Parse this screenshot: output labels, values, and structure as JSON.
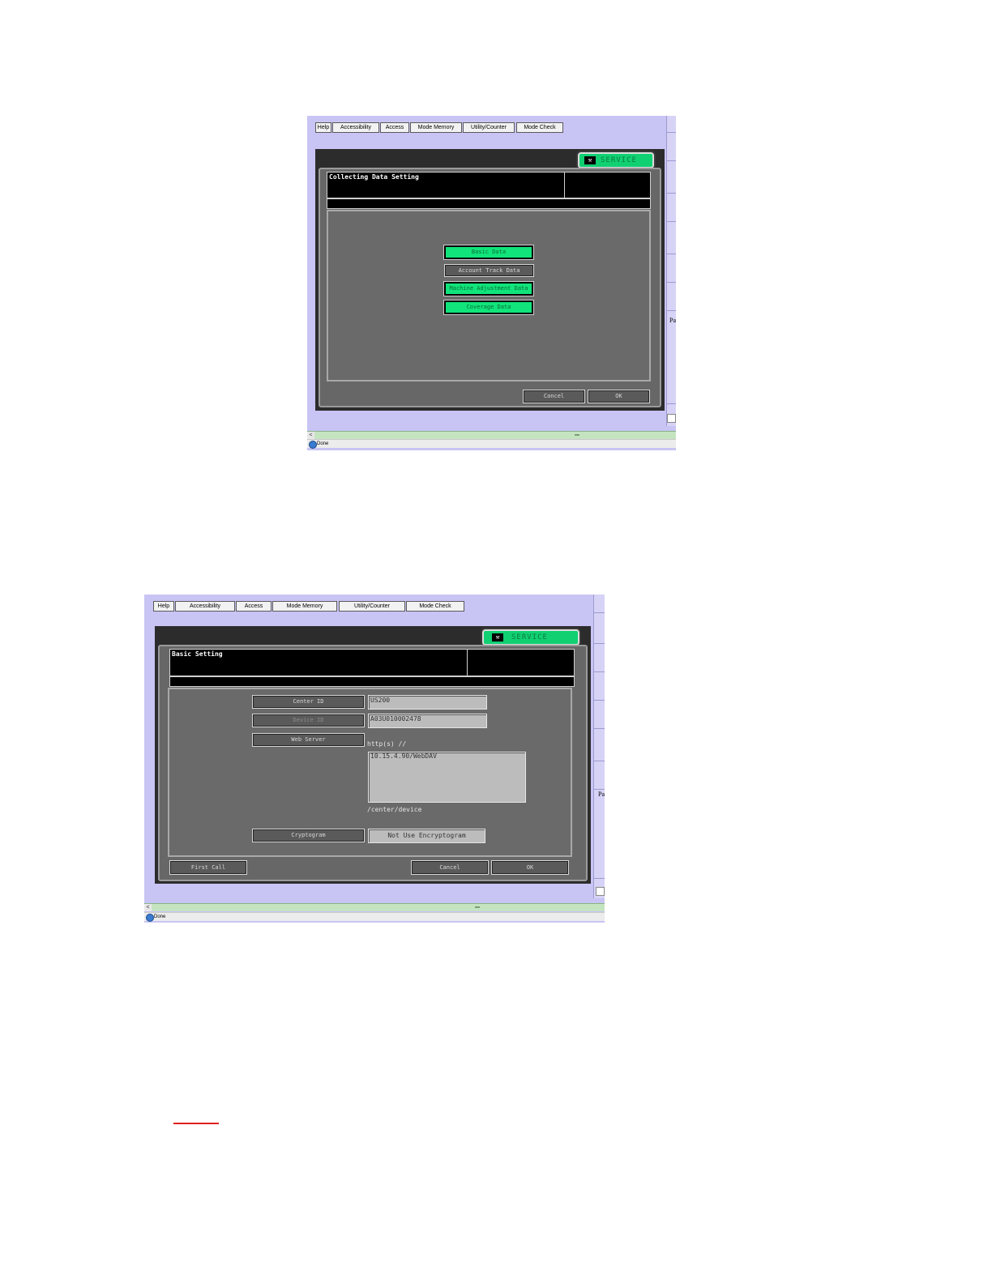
{
  "tabs": [
    "Help",
    "Accessibility",
    "Access",
    "Mode Memory",
    "Utility/Counter",
    "Mode Check"
  ],
  "service_label": "SERVICE",
  "service_icon": "wrench-icon",
  "edge_text": "Pa",
  "status_text": "Done",
  "screen1": {
    "title": "Collecting Data Setting",
    "options": [
      {
        "label": "Basic Data",
        "selected": true
      },
      {
        "label": "Account Track Data",
        "selected": false
      },
      {
        "label": "Machine Adjustment Data",
        "selected": true
      },
      {
        "label": "Coverage Data",
        "selected": true
      }
    ],
    "cancel_label": "Cancel",
    "ok_label": "OK"
  },
  "screen2": {
    "title": "Basic Setting",
    "center_id_label": "Center ID",
    "center_id_value": "US200",
    "device_id_label": "Device ID",
    "device_id_value": "A03U010002478",
    "web_server_label": "Web Server",
    "url_prefix": "http(s) //",
    "url_value": "10.15.4.90/WebDAV",
    "url_suffix": "/center/device",
    "cryptogram_label": "Cryptogram",
    "cryptogram_value": "Not Use Encryptogram",
    "first_call_label": "First Call",
    "cancel_label": "Cancel",
    "ok_label": "OK"
  },
  "colors": {
    "selected_button": "#10e47a",
    "frame_background": "#c8c4f4",
    "panel_background": "#676767",
    "annotation_line": "#e02020"
  }
}
